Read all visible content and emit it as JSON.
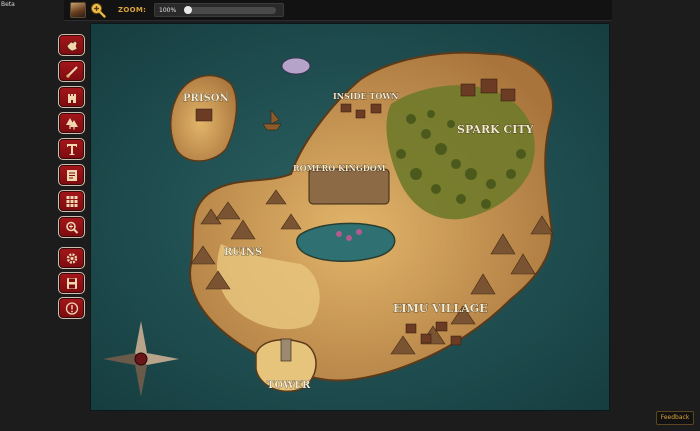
{
  "app": {
    "badge": "Beta",
    "avatar_icon": "character-portrait-icon",
    "zoom": {
      "icon": "zoom-in-icon",
      "label": "ZOOM:",
      "value": "100%",
      "level_fraction": 0.0
    },
    "feedback_label": "Feedback"
  },
  "toolbar": {
    "tools": [
      {
        "name": "hand-tool-button",
        "icon": "hand-pointer-icon"
      },
      {
        "name": "brush-tool-button",
        "icon": "brush-icon"
      },
      {
        "name": "building-tool-button",
        "icon": "tower-building-icon"
      },
      {
        "name": "tree-tool-button",
        "icon": "tree-icon"
      },
      {
        "name": "text-tool-button",
        "icon": "text-t-icon"
      },
      {
        "name": "notes-tool-button",
        "icon": "notes-icon"
      },
      {
        "name": "grid-tool-button",
        "icon": "grid-icon"
      },
      {
        "name": "zoom-tool-button",
        "icon": "magnifier-icon"
      },
      {
        "name": "settings-button",
        "icon": "gear-icon"
      },
      {
        "name": "save-button",
        "icon": "floppy-disk-icon"
      },
      {
        "name": "info-button",
        "icon": "exclamation-icon"
      }
    ]
  },
  "map": {
    "labels": {
      "prison": "PRISON",
      "inside_town": "INSIDE TOWN",
      "spark_city": "SPARK CITY",
      "romero_kingdom": "ROMERO KINGDOM",
      "ruins": "RUINS",
      "eimu_village": "EIMU VILLAGE",
      "tower": "TOWER"
    },
    "colors": {
      "sea": "#1d4a4c",
      "land": "#c99a55",
      "sand": "#e1bd72",
      "forest": "#6f7a2a",
      "mountain": "#7a5432",
      "accent": "#d9a33a",
      "tool_red": "#9c1419"
    }
  }
}
